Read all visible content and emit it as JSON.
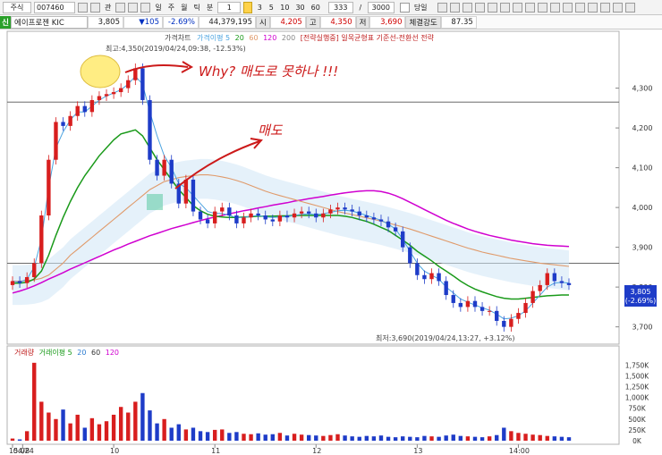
{
  "toolbar": {
    "market": "주식",
    "code": "007460",
    "buttons": [
      "관",
      "일",
      "주",
      "월",
      "틱",
      "분"
    ],
    "interval_value": "1",
    "interval_options": [
      "3",
      "5",
      "10",
      "30",
      "60"
    ],
    "count": "333",
    "total": "3000",
    "slash": "/",
    "today_label": "당일"
  },
  "info": {
    "name": "에이프로젠 KIC",
    "price": "3,805",
    "change": "▼105",
    "change_pct": "-2.69%",
    "volume": "44,379,195",
    "open_label": "시",
    "open": "4,205",
    "high_label": "고",
    "high": "4,350",
    "low_label": "저",
    "low": "3,690",
    "strength_label": "체결강도",
    "strength": "87.35"
  },
  "colors": {
    "up": "#d81e1e",
    "down": "#1e3cc8",
    "ma5": "#4aa3e0",
    "ma20": "#1a9a1a",
    "ma60": "#e09a6a",
    "ma120": "#d000d0",
    "annot": "#cc1a1a"
  },
  "price_panel": {
    "legend": [
      "가격차트",
      "가격이평 5",
      "20",
      "60",
      "120",
      "200",
      "[전략실행중] 일목균형표 기준선-전환선 전략"
    ],
    "max_label": "최고:4,350(2019/04/24,09:38, -12.53%)",
    "min_label": "최저:3,690(2019/04/24,13:27, +3.12%)",
    "current_price": "3,805",
    "current_pct": "(-2.69%)",
    "annot_why": "Why? 매도로 못하나 !!!",
    "annot_sell": "매도"
  },
  "volume_panel": {
    "legend": [
      "거래량",
      "거래이평 5",
      "20",
      "60",
      "120"
    ]
  },
  "chart_data": {
    "type": "candlestick",
    "y_ticks": [
      3700,
      3800,
      3900,
      4000,
      4100,
      4200,
      4300
    ],
    "y_tick_labels": [
      "3,700",
      "3,800",
      "3,900",
      "4,000",
      "4,100",
      "4,200",
      "4,300"
    ],
    "x_tick_labels": [
      "15:08",
      "04/24",
      "10",
      "11",
      "12",
      "13",
      "14:00"
    ],
    "x_tick_time": [
      0,
      6,
      60,
      120,
      180,
      240,
      300
    ],
    "price_max": 4350,
    "price_min": 3690,
    "hlines": [
      4265,
      3860
    ],
    "close": [
      3815,
      3810,
      3825,
      3860,
      3980,
      4120,
      4215,
      4205,
      4230,
      4255,
      4240,
      4270,
      4280,
      4285,
      4290,
      4300,
      4320,
      4350,
      4270,
      4120,
      4080,
      4120,
      4060,
      4010,
      4070,
      3990,
      3970,
      3960,
      3990,
      4000,
      3980,
      3960,
      3975,
      3985,
      3980,
      3970,
      3965,
      3980,
      3975,
      3985,
      3990,
      3985,
      3975,
      3985,
      3995,
      4000,
      3995,
      3990,
      3980,
      3975,
      3970,
      3965,
      3950,
      3940,
      3900,
      3860,
      3830,
      3820,
      3835,
      3815,
      3780,
      3760,
      3750,
      3765,
      3750,
      3740,
      3740,
      3715,
      3700,
      3720,
      3735,
      3760,
      3790,
      3805,
      3835,
      3815,
      3810,
      3805
    ],
    "ma5": [
      3815,
      3812,
      3820,
      3850,
      3920,
      4050,
      4150,
      4190,
      4220,
      4240,
      4240,
      4255,
      4270,
      4280,
      4288,
      4296,
      4310,
      4330,
      4310,
      4240,
      4180,
      4130,
      4100,
      4060,
      4050,
      4030,
      4010,
      3990,
      3985,
      3985,
      3980,
      3975,
      3975,
      3978,
      3980,
      3976,
      3975,
      3976,
      3977,
      3980,
      3983,
      3984,
      3982,
      3984,
      3988,
      3992,
      3993,
      3991,
      3986,
      3980,
      3974,
      3968,
      3958,
      3946,
      3920,
      3890,
      3860,
      3840,
      3830,
      3820,
      3800,
      3785,
      3770,
      3762,
      3755,
      3748,
      3742,
      3732,
      3720,
      3722,
      3728,
      3740,
      3760,
      3780,
      3800,
      3810,
      3812,
      3810
    ],
    "ma20": [
      3810,
      3810,
      3812,
      3820,
      3840,
      3880,
      3930,
      3975,
      4015,
      4050,
      4080,
      4105,
      4130,
      4150,
      4170,
      4185,
      4190,
      4195,
      4180,
      4150,
      4120,
      4095,
      4070,
      4045,
      4025,
      4005,
      3992,
      3983,
      3978,
      3976,
      3975,
      3975,
      3976,
      3977,
      3978,
      3978,
      3978,
      3979,
      3979,
      3980,
      3980,
      3980,
      3980,
      3980,
      3980,
      3980,
      3978,
      3975,
      3970,
      3965,
      3958,
      3950,
      3942,
      3930,
      3918,
      3905,
      3890,
      3878,
      3866,
      3852,
      3840,
      3828,
      3815,
      3804,
      3795,
      3788,
      3782,
      3776,
      3772,
      3770,
      3770,
      3772,
      3774,
      3776,
      3778,
      3779,
      3780,
      3780
    ],
    "ma60": [
      3815,
      3815,
      3816,
      3818,
      3822,
      3830,
      3845,
      3860,
      3880,
      3895,
      3910,
      3925,
      3940,
      3955,
      3970,
      3985,
      4000,
      4015,
      4030,
      4045,
      4055,
      4065,
      4070,
      4075,
      4078,
      4080,
      4082,
      4082,
      4080,
      4077,
      4073,
      4068,
      4062,
      4055,
      4048,
      4041,
      4035,
      4030,
      4025,
      4020,
      4015,
      4010,
      4005,
      4000,
      3995,
      3990,
      3986,
      3982,
      3978,
      3974,
      3970,
      3966,
      3961,
      3956,
      3951,
      3946,
      3940,
      3934,
      3928,
      3922,
      3916,
      3910,
      3904,
      3898,
      3893,
      3888,
      3884,
      3880,
      3876,
      3872,
      3869,
      3866,
      3863,
      3860,
      3858,
      3856,
      3854,
      3852
    ],
    "ma120": [
      3785,
      3790,
      3796,
      3803,
      3811,
      3820,
      3828,
      3836,
      3845,
      3853,
      3861,
      3869,
      3877,
      3885,
      3893,
      3900,
      3908,
      3915,
      3922,
      3929,
      3935,
      3941,
      3947,
      3952,
      3957,
      3962,
      3967,
      3972,
      3976,
      3980,
      3984,
      3988,
      3992,
      3995,
      3999,
      4002,
      4006,
      4009,
      4012,
      4016,
      4019,
      4022,
      4025,
      4028,
      4031,
      4034,
      4037,
      4039,
      4041,
      4042,
      4042,
      4040,
      4036,
      4030,
      4022,
      4013,
      4004,
      3995,
      3986,
      3977,
      3968,
      3960,
      3953,
      3946,
      3940,
      3935,
      3930,
      3926,
      3922,
      3918,
      3915,
      3912,
      3909,
      3907,
      3905,
      3904,
      3903,
      3902
    ],
    "volume": [
      50,
      30,
      220,
      1800,
      900,
      650,
      500,
      720,
      400,
      600,
      300,
      520,
      380,
      450,
      600,
      780,
      650,
      900,
      1100,
      700,
      400,
      500,
      300,
      380,
      260,
      300,
      220,
      200,
      250,
      260,
      180,
      200,
      160,
      150,
      170,
      140,
      150,
      180,
      120,
      160,
      140,
      130,
      120,
      110,
      130,
      150,
      120,
      100,
      90,
      110,
      100,
      120,
      90,
      80,
      100,
      90,
      80,
      110,
      100,
      90,
      120,
      140,
      110,
      100,
      90,
      80,
      100,
      130,
      300,
      220,
      180,
      160,
      140,
      130,
      110,
      100,
      90,
      80
    ],
    "volume_ticks": [
      0,
      250000,
      500000,
      750000,
      1000000,
      1250000,
      1500000,
      1750000
    ],
    "volume_tick_labels": [
      "0K",
      "250K",
      "500K",
      "750K",
      "1,000K",
      "1,250K",
      "1,500K",
      "1,750K"
    ],
    "volume_unit_max": 1900
  }
}
